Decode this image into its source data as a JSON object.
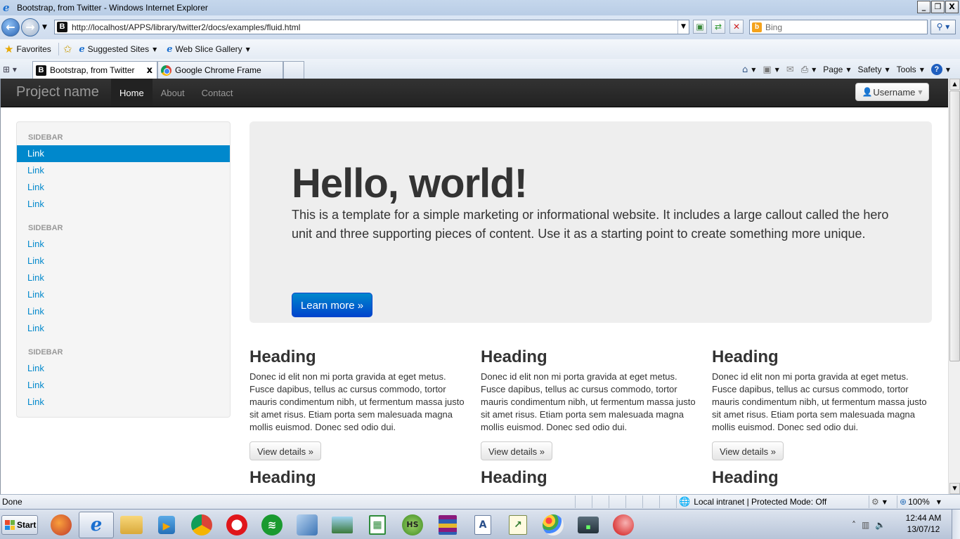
{
  "window": {
    "title": "Bootstrap, from Twitter - Windows Internet Explorer",
    "minimize": "_",
    "restore": "❐",
    "close": "X"
  },
  "address": {
    "url": "http://localhost/APPS/library/twitter2/docs/examples/fluid.html",
    "search_placeholder": "Bing"
  },
  "favorites": {
    "label": "Favorites",
    "items": [
      "Suggested Sites",
      "Web Slice Gallery"
    ]
  },
  "tabs": [
    {
      "label": "Bootstrap, from Twitter",
      "close": "x"
    },
    {
      "label": "Google Chrome Frame"
    }
  ],
  "commands": {
    "page": "Page",
    "safety": "Safety",
    "tools": "Tools"
  },
  "navbar": {
    "brand": "Project name",
    "links": [
      "Home",
      "About",
      "Contact"
    ],
    "user_button": "Username"
  },
  "sidebar": {
    "sections": [
      {
        "header": "SIDEBAR",
        "links": [
          "Link",
          "Link",
          "Link",
          "Link"
        ]
      },
      {
        "header": "SIDEBAR",
        "links": [
          "Link",
          "Link",
          "Link",
          "Link",
          "Link",
          "Link"
        ]
      },
      {
        "header": "SIDEBAR",
        "links": [
          "Link",
          "Link",
          "Link"
        ]
      }
    ],
    "active_link": 0
  },
  "hero": {
    "heading": "Hello, world!",
    "text": "This is a template for a simple marketing or informational website. It includes a large callout called the hero unit and three supporting pieces of content. Use it as a starting point to create something more unique.",
    "button": "Learn more »"
  },
  "columns": [
    {
      "heading": "Heading",
      "text": "Donec id elit non mi porta gravida at eget metus. Fusce dapibus, tellus ac cursus commodo, tortor mauris condimentum nibh, ut fermentum massa justo sit amet risus. Etiam porta sem malesuada magna mollis euismod. Donec sed odio dui.",
      "button": "View details »"
    },
    {
      "heading": "Heading",
      "text": "Donec id elit non mi porta gravida at eget metus. Fusce dapibus, tellus ac cursus commodo, tortor mauris condimentum nibh, ut fermentum massa justo sit amet risus. Etiam porta sem malesuada magna mollis euismod. Donec sed odio dui.",
      "button": "View details »"
    },
    {
      "heading": "Heading",
      "text": "Donec id elit non mi porta gravida at eget metus. Fusce dapibus, tellus ac cursus commodo, tortor mauris condimentum nibh, ut fermentum massa justo sit amet risus. Etiam porta sem malesuada magna mollis euismod. Donec sed odio dui.",
      "button": "View details »"
    },
    {
      "heading": "Heading"
    },
    {
      "heading": "Heading"
    },
    {
      "heading": "Heading"
    }
  ],
  "status": {
    "text": "Done",
    "zone": "Local intranet | Protected Mode: Off",
    "zoom": "100%"
  },
  "taskbar": {
    "start": "Start",
    "hs_label": "HS",
    "time": "12:44 AM",
    "date": "13/07/12"
  },
  "colors": {
    "link": "#0088cc",
    "navbar": "#222222",
    "hero_bg": "#eeeeee",
    "primary_button": "#0044cc"
  },
  "icons": [
    "ie-logo-icon",
    "back-arrow-icon",
    "forward-arrow-icon",
    "refresh-icon",
    "stop-icon",
    "compat-view-icon",
    "search-icon",
    "star-icon",
    "add-favorite-icon",
    "home-icon",
    "feed-icon",
    "mail-icon",
    "print-icon",
    "help-icon",
    "user-icon",
    "globe-icon",
    "zoom-icon"
  ]
}
